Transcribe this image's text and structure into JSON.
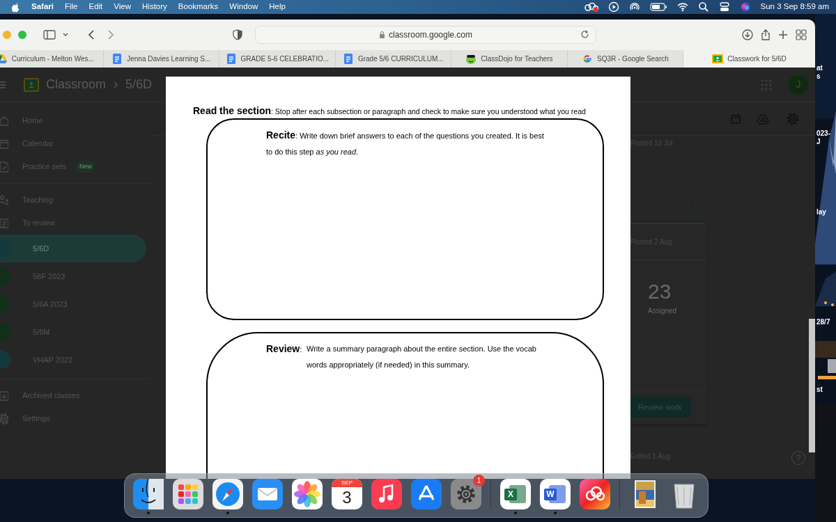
{
  "menu_bar": {
    "app": "Safari",
    "menus": [
      "File",
      "Edit",
      "View",
      "History",
      "Bookmarks",
      "Window",
      "Help"
    ],
    "status_icons": [
      {
        "kind": "cloud",
        "alert": true
      },
      {
        "kind": "play",
        "alert": false
      },
      {
        "kind": "airdrop",
        "alert": false
      },
      {
        "kind": "battery",
        "alert": false
      },
      {
        "kind": "wifi",
        "alert": false
      },
      {
        "kind": "search",
        "alert": false
      },
      {
        "kind": "control",
        "alert": false
      },
      {
        "kind": "siri",
        "alert": false
      }
    ],
    "clock": "Sun 3 Sep  8:59 am"
  },
  "browser": {
    "address": "classroom.google.com",
    "tabs": [
      {
        "kind": "drive",
        "label": "Curriculum - Melton Wes...",
        "selected": false
      },
      {
        "kind": "docs",
        "label": "Jenna Davies Learning S...",
        "selected": false
      },
      {
        "kind": "docs",
        "label": "GRADE 5-6 CELEBRATIO...",
        "selected": false
      },
      {
        "kind": "docs",
        "label": "Grade 5/6 CURRICULUM...",
        "selected": false
      },
      {
        "kind": "dojo",
        "label": "ClassDojo for Teachers",
        "selected": false
      },
      {
        "kind": "google",
        "label": "SQ3R - Google Search",
        "selected": false
      },
      {
        "kind": "classroom",
        "label": "Classwork for 5/6D",
        "selected": true
      }
    ]
  },
  "classroom": {
    "brand": "Classroom",
    "breadcrumb": "5/6D",
    "avatar": "J",
    "help": "?",
    "nav_sections": [
      {
        "items": [
          {
            "kind": "home",
            "label": "Home",
            "selected": false
          },
          {
            "kind": "calendar",
            "label": "Calendar",
            "selected": false
          },
          {
            "kind": "practice",
            "label": "Practice sets",
            "badge": "New",
            "selected": false
          }
        ]
      },
      {
        "items": [
          {
            "kind": "teaching",
            "label": "Teaching",
            "selected": false
          },
          {
            "kind": "review",
            "label": "To review",
            "selected": false
          },
          {
            "kind": "class",
            "label": "5/6D",
            "color": "#123a3c",
            "selected": true
          },
          {
            "kind": "class",
            "label": "56F 2023",
            "color": "#123019",
            "selected": false
          },
          {
            "kind": "class",
            "label": "5/6A 2023",
            "color": "#123019",
            "selected": false
          },
          {
            "kind": "class",
            "label": "5/6M",
            "color": "#123019",
            "selected": false
          },
          {
            "kind": "class",
            "label": "VHAP 2022",
            "color": "#123a3c",
            "selected": false
          }
        ]
      },
      {
        "items": [
          {
            "kind": "archive",
            "label": "Archived classes",
            "selected": false
          },
          {
            "kind": "settings",
            "label": "Settings",
            "selected": false
          }
        ]
      }
    ],
    "stream": {
      "first_posted": "Posted 13 Jul",
      "card_posted": "Posted 2 Aug",
      "count": "23",
      "count_label": "Assigned",
      "button": "Review work",
      "edited": "Edited 1 Aug"
    }
  },
  "document": {
    "heading": "**Read the section**: Stop after each subsection or paragraph and check to make sure you understood what you read",
    "boxes": [
      {
        "kind": "inline",
        "text": "**Recite**: Write down brief answers to each of the questions you created.  It is best to do this step *as you read*."
      },
      {
        "kind": "hanging",
        "label": "**Review**:",
        "text": "Write a summary paragraph about the entire section.  Use the vocab words appropriately (if needed) in this summary."
      }
    ]
  },
  "desktop_labels": [
    "at",
    "s",
    "023-",
    "J",
    "lay",
    "28/7",
    "st"
  ],
  "dock": {
    "apps": [
      {
        "kind": "finder",
        "running": true
      },
      {
        "kind": "launchpad",
        "running": false
      },
      {
        "kind": "safari",
        "running": true
      },
      {
        "kind": "mail",
        "running": false
      },
      {
        "kind": "photos",
        "running": false
      },
      {
        "kind": "calendar",
        "month": "SEP",
        "day": "3",
        "running": false
      },
      {
        "kind": "music",
        "running": false
      },
      {
        "kind": "appstore",
        "running": false
      },
      {
        "kind": "settings",
        "badge": "1",
        "running": false
      },
      {
        "kind": "separator"
      },
      {
        "kind": "excel",
        "letter": "X",
        "running": true
      },
      {
        "kind": "word",
        "letter": "W",
        "running": true
      },
      {
        "kind": "cloud",
        "running": false
      },
      {
        "kind": "separator"
      },
      {
        "kind": "preview",
        "running": false
      },
      {
        "kind": "trash",
        "running": false
      }
    ]
  }
}
